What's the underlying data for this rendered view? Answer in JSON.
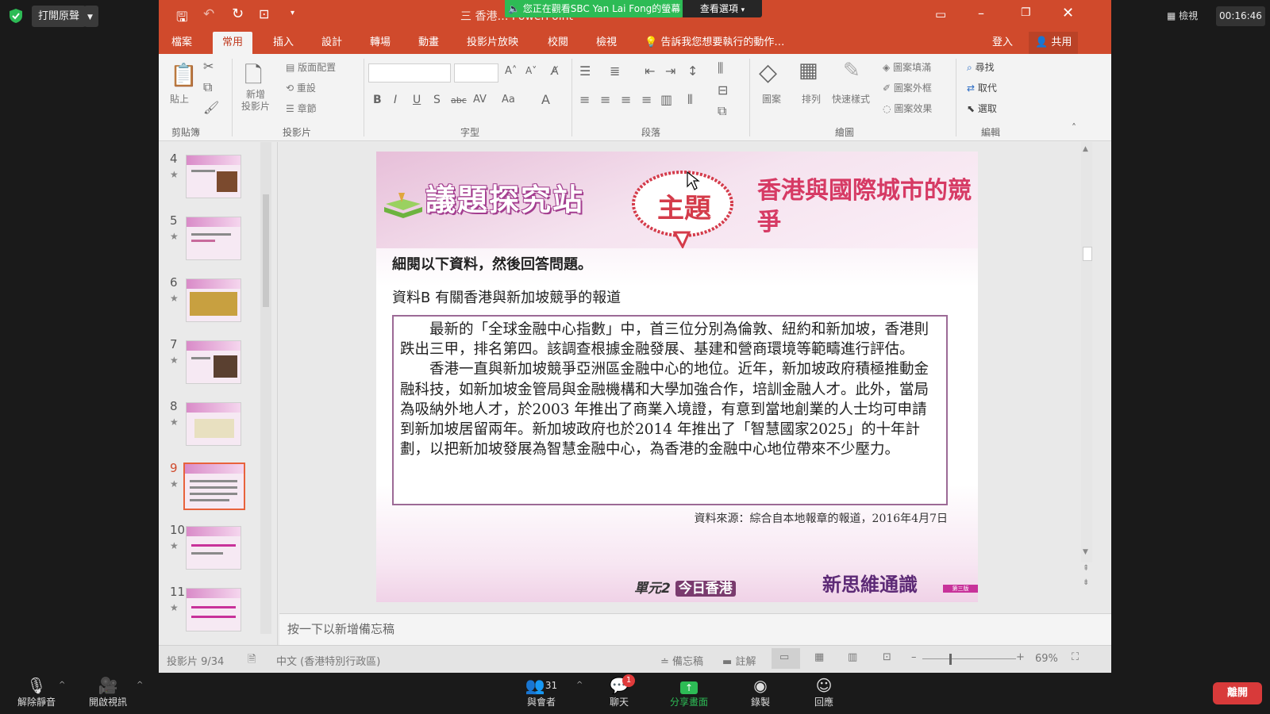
{
  "zoom_top": {
    "open_captions_label": "打開原聲",
    "view_label": "檢視",
    "timer": "00:16:46"
  },
  "share_banner": {
    "text": "您正在觀看SBC Yan Lai Fong的螢幕",
    "view_options": "查看選項"
  },
  "ppt": {
    "window_title": "三 香港… PowerPoint",
    "tabs": [
      "檔案",
      "常用",
      "插入",
      "設計",
      "轉場",
      "動畫",
      "投影片放映",
      "校閱",
      "檢視"
    ],
    "tell_me": "告訴我您想要執行的動作…",
    "sign_in": "登入",
    "share": "共用",
    "ribbon": {
      "paste": "貼上",
      "clipboard_group": "剪貼簿",
      "new_slide": "新增\n投影片",
      "layout": "版面配置",
      "reset": "重設",
      "section": "章節",
      "slides_group": "投影片",
      "font_group": "字型",
      "paragraph_group": "段落",
      "shapes": "圖案",
      "arrange": "排列",
      "quick_styles": "快速樣式",
      "shape_fill": "圖案填滿",
      "shape_outline": "圖案外框",
      "shape_effects": "圖案效果",
      "drawing_group": "繪圖",
      "find": "尋找",
      "replace": "取代",
      "select": "選取",
      "editing_group": "編輯"
    },
    "thumbnails": [
      {
        "num": "4"
      },
      {
        "num": "5"
      },
      {
        "num": "6"
      },
      {
        "num": "7"
      },
      {
        "num": "8"
      },
      {
        "num": "9"
      },
      {
        "num": "10"
      },
      {
        "num": "11"
      }
    ],
    "active_slide": "9",
    "notes_placeholder": "按一下以新增備忘稿",
    "status": {
      "slide_count": "投影片 9/34",
      "language": "中文 (香港特別行政區)",
      "notes": "備忘稿",
      "comments": "註解",
      "zoom": "69%"
    }
  },
  "slide": {
    "brand": "議題探究站",
    "bubble": "主題",
    "topic": "香港與國際城市的競爭",
    "instruction": "細閱以下資料，然後回答問題。",
    "source_title": "資料B  有關香港與新加坡競爭的報道",
    "paragraph1": "最新的「全球金融中心指數」中，首三位分別為倫敦、紐約和新加坡，香港則跌出三甲，排名第四。該調查根據金融發展、基建和營商環境等範疇進行評估。",
    "paragraph2": "香港一直與新加坡競爭亞洲區金融中心的地位。近年，新加坡政府積極推動金融科技，如新加坡金管局與金融機構和大學加強合作，培訓金融人才。此外，當局為吸納外地人才，於2003 年推出了商業入境證，有意到當地創業的人士均可申請到新加坡居留兩年。新加坡政府也於2014 年推出了「智慧國家2025」的十年計劃，以把新加坡發展為智慧金融中心，為香港的金融中心地位帶來不少壓力。",
    "citation": "資料來源：綜合自本地報章的報道，2016年4月7日",
    "unit": "單元2",
    "unit_name": "今日香港",
    "series": "新思維通識",
    "series_tag": "第三版"
  },
  "zoom_bottom": {
    "unmute": "解除靜音",
    "start_video": "開啟視訊",
    "participants": "與會者",
    "participants_count": "31",
    "chat": "聊天",
    "chat_badge": "1",
    "share_screen": "分享畫面",
    "record": "錄製",
    "reactions": "回應",
    "leave": "離開"
  },
  "colors": {
    "ppt_red": "#d04a2c",
    "zoom_green": "#2dbb55",
    "leave_red": "#d83a3a",
    "topic_pink": "#d63a64"
  }
}
